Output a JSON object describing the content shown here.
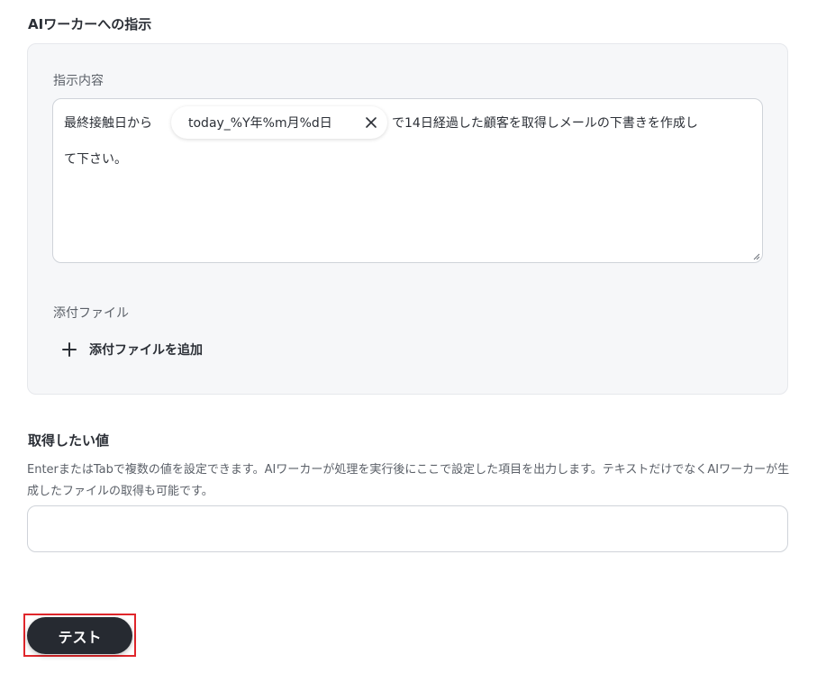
{
  "ai_worker_section": {
    "title": "AIワーカーへの指示",
    "instruction_label": "指示内容",
    "instruction": {
      "before_chip": "最終接触日から",
      "chip_text": "today_%Y年%m月%d日",
      "after_chip": "で14日経過した顧客を取得しメールの下書きを作成し",
      "second_line": "て下さい。"
    },
    "attachment_label": "添付ファイル",
    "add_attachment_label": "添付ファイルを追加"
  },
  "output_section": {
    "title": "取得したい値",
    "description": "EnterまたはTabで複数の値を設定できます。AIワーカーが処理を実行後にここで設定した項目を出力します。テキストだけでなくAIワーカーが生成したファイルの取得も可能です。",
    "input_value": ""
  },
  "test_button": {
    "label": "テスト"
  },
  "colors": {
    "panel_bg": "#f6f7f9",
    "button_bg": "#262a31",
    "highlight": "#e0262b"
  }
}
